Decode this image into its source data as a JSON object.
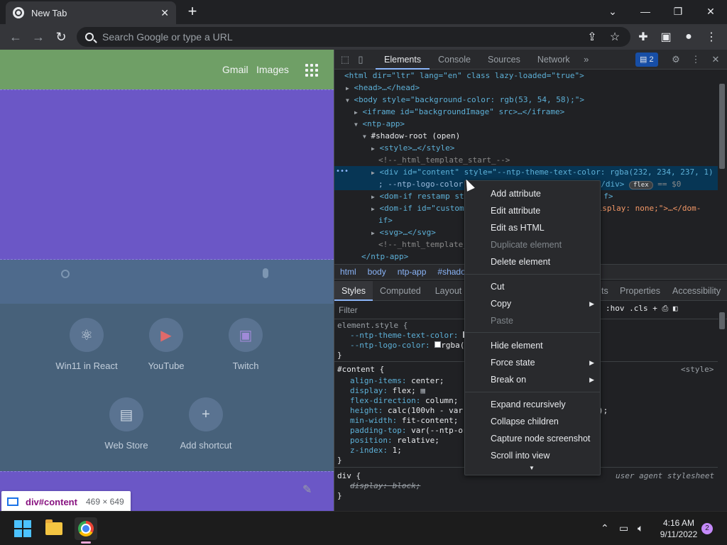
{
  "browser": {
    "tab_title": "New Tab",
    "omnibox_placeholder": "Search Google or type a URL"
  },
  "page": {
    "header_links": [
      "Gmail",
      "Images"
    ],
    "shortcuts": [
      {
        "label": "Win11 in React",
        "icon": "react-icon"
      },
      {
        "label": "YouTube",
        "icon": "youtube-icon"
      },
      {
        "label": "Twitch",
        "icon": "twitch-icon"
      },
      {
        "label": "Web Store",
        "icon": "webstore-icon"
      },
      {
        "label": "Add shortcut",
        "icon": "plus-icon"
      }
    ],
    "tooltip": {
      "tag": "div#content",
      "size": "469 × 649"
    }
  },
  "devtools": {
    "tabs": [
      "Elements",
      "Console",
      "Sources",
      "Network"
    ],
    "issues_count": "2",
    "dom_lines": {
      "l1": "<html dir=\"ltr\" lang=\"en\" class lazy-loaded=\"true\">",
      "l2": "<head>…</head>",
      "l3": "<body style=\"background-color: rgb(53, 54, 58);\">",
      "l4": "<iframe id=\"backgroundImage\" src>…</iframe>",
      "l5": "<ntp-app>",
      "l6": "#shadow-root (open)",
      "l7": "<style>…</style>",
      "l8": "<!--_html_template_start_-->",
      "l9": "<div id=\"content\" style=\"--ntp-theme-text-color: rgba(232, 234, 237, 1)",
      "l10a": "; --ntp-logo-color",
      "l10b": "/div>",
      "l10_badge": "flex",
      "l10_eq": "== $0",
      "l11a": "<dom-if restamp sty",
      "l11b": "f>",
      "l12a": "<dom-if id=\"custom",
      "l12b": "isplay: none;\">…</dom-",
      "l13": "if>",
      "l14": "<svg>…</svg>",
      "l15": "<!--_html_template_",
      "l16": "</ntp-app>"
    },
    "breadcrumbs": [
      "html",
      "body",
      "ntp-app",
      "#shadow"
    ],
    "style_tabs": [
      "Styles",
      "Computed",
      "Layout",
      "ts",
      "Properties",
      "Accessibility"
    ],
    "filter_placeholder": "Filter",
    "filter_tools": ":hov  .cls  +",
    "styles": {
      "s1": "element.style {",
      "s2p": "--ntp-theme-text-color:",
      "s3p": "--ntp-logo-color:",
      "s3v": "rgba(",
      "s4": "}",
      "s5": "#content {",
      "s5src": "<style>",
      "s6p": "align-items:",
      "s6v": "center;",
      "s7p": "display:",
      "s7v": "flex;",
      "s8p": "flex-direction:",
      "s8v": "column;",
      "s9p": "height:",
      "s9v": "calc(100vh - var",
      "s9end": ");",
      "s10p": "min-width:",
      "s10v": "fit-content;",
      "s11p": "padding-top:",
      "s11v": "var(--ntp-or",
      "s12p": "position:",
      "s12v": "relative;",
      "s13p": "z-index:",
      "s13v": "1;",
      "s14": "}",
      "s15": "div {",
      "s15src": "user agent stylesheet",
      "s16p": "display:",
      "s16v": "block;",
      "s17": "}"
    }
  },
  "context_menu": {
    "items": [
      "Add attribute",
      "Edit attribute",
      "Edit as HTML",
      "Duplicate element",
      "Delete element",
      "Cut",
      "Copy",
      "Paste",
      "Hide element",
      "Force state",
      "Break on",
      "Expand recursively",
      "Collapse children",
      "Capture node screenshot",
      "Scroll into view"
    ]
  },
  "taskbar": {
    "time": "4:16 AM",
    "date": "9/11/2022",
    "notifications": "2"
  }
}
